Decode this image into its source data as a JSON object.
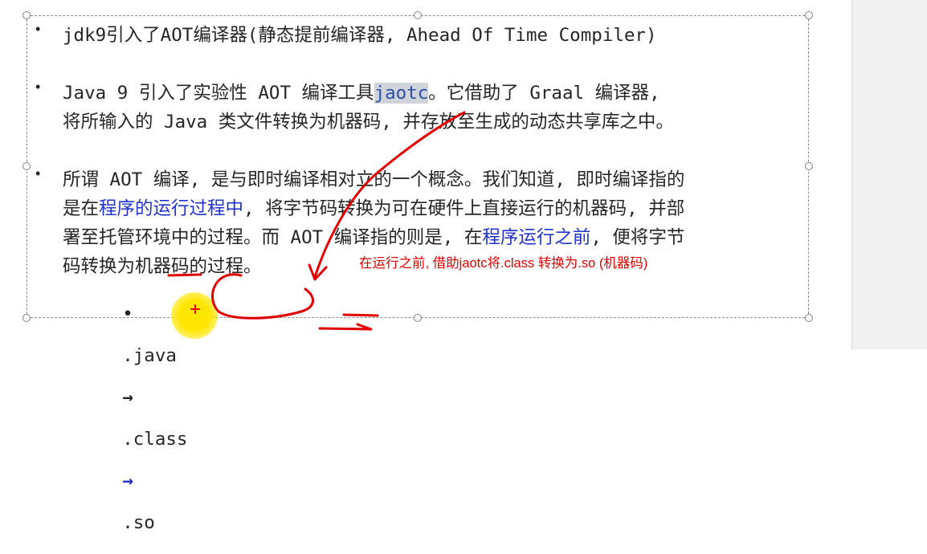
{
  "slide": {
    "bullets": [
      {
        "lines": [
          [
            {
              "text": "jdk9引入了AOT编译器(静态提前编译器, Ahead Of Time Compiler)"
            }
          ]
        ]
      },
      {
        "lines": [
          [
            {
              "text": "Java 9 引入了实验性 AOT 编译工具"
            },
            {
              "text": "jaotc",
              "style": "hl"
            },
            {
              "text": "。它借助了 Graal 编译器,"
            }
          ],
          [
            {
              "text": "将所输入的 Java 类文件转换为机器码, 并存放至生成的动态共享库之中。"
            }
          ]
        ]
      },
      {
        "lines": [
          [
            {
              "text": "所谓 AOT 编译, 是与即时编译相对立的一个概念。我们知道, 即时编译指的"
            }
          ],
          [
            {
              "text": "是在"
            },
            {
              "text": "程序的运行过程中",
              "style": "blue"
            },
            {
              "text": ", 将字节码转换为可在硬件上直接运行的机器码, 并部"
            }
          ],
          [
            {
              "text": "署至托管环境中的过程。而 AOT 编译指的则是, 在"
            },
            {
              "text": "程序运行之前",
              "style": "blue"
            },
            {
              "text": ", 便将字节"
            }
          ],
          [
            {
              "text": "码转换为机器码的过程。"
            }
          ]
        ]
      }
    ],
    "sub_bullet": {
      "marker": "•",
      "java": ".java",
      "arrow1": "→",
      "class": ".class",
      "arrow2": "→",
      "so": ".so"
    },
    "bullet_marker": "•"
  },
  "annotation": {
    "text": "在运行之前, 借助jaotc将.class 转换为.so (机器码)",
    "color": "#e00000"
  },
  "colors": {
    "text": "#262626",
    "highlight_bg": "#cfd3da",
    "link_blue": "#2233cc",
    "ink_red": "#e00000",
    "cursor_yellow": "#ffe600",
    "panel": "#f1f1f1"
  }
}
